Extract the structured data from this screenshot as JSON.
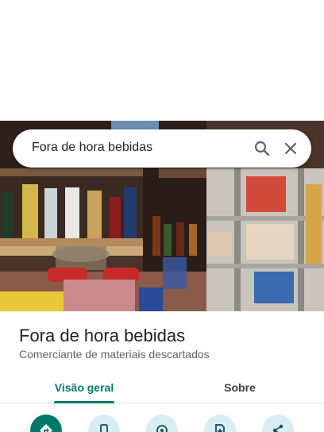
{
  "search": {
    "query": "Fora de hora bebidas"
  },
  "place": {
    "name": "Fora de hora bebidas",
    "category": "Comerciante de materiais descartados"
  },
  "tabs": [
    {
      "label": "Visão geral",
      "active": true
    },
    {
      "label": "Sobre",
      "active": false
    }
  ],
  "actions": [
    {
      "icon": "directions-icon"
    },
    {
      "icon": "phone-icon"
    },
    {
      "icon": "nearby-icon"
    },
    {
      "icon": "save-icon"
    },
    {
      "icon": "share-icon"
    }
  ],
  "colors": {
    "accent": "#00796b",
    "action_bg": "#d8eef3",
    "title_text": "#202124",
    "secondary_text": "#5f6368"
  }
}
